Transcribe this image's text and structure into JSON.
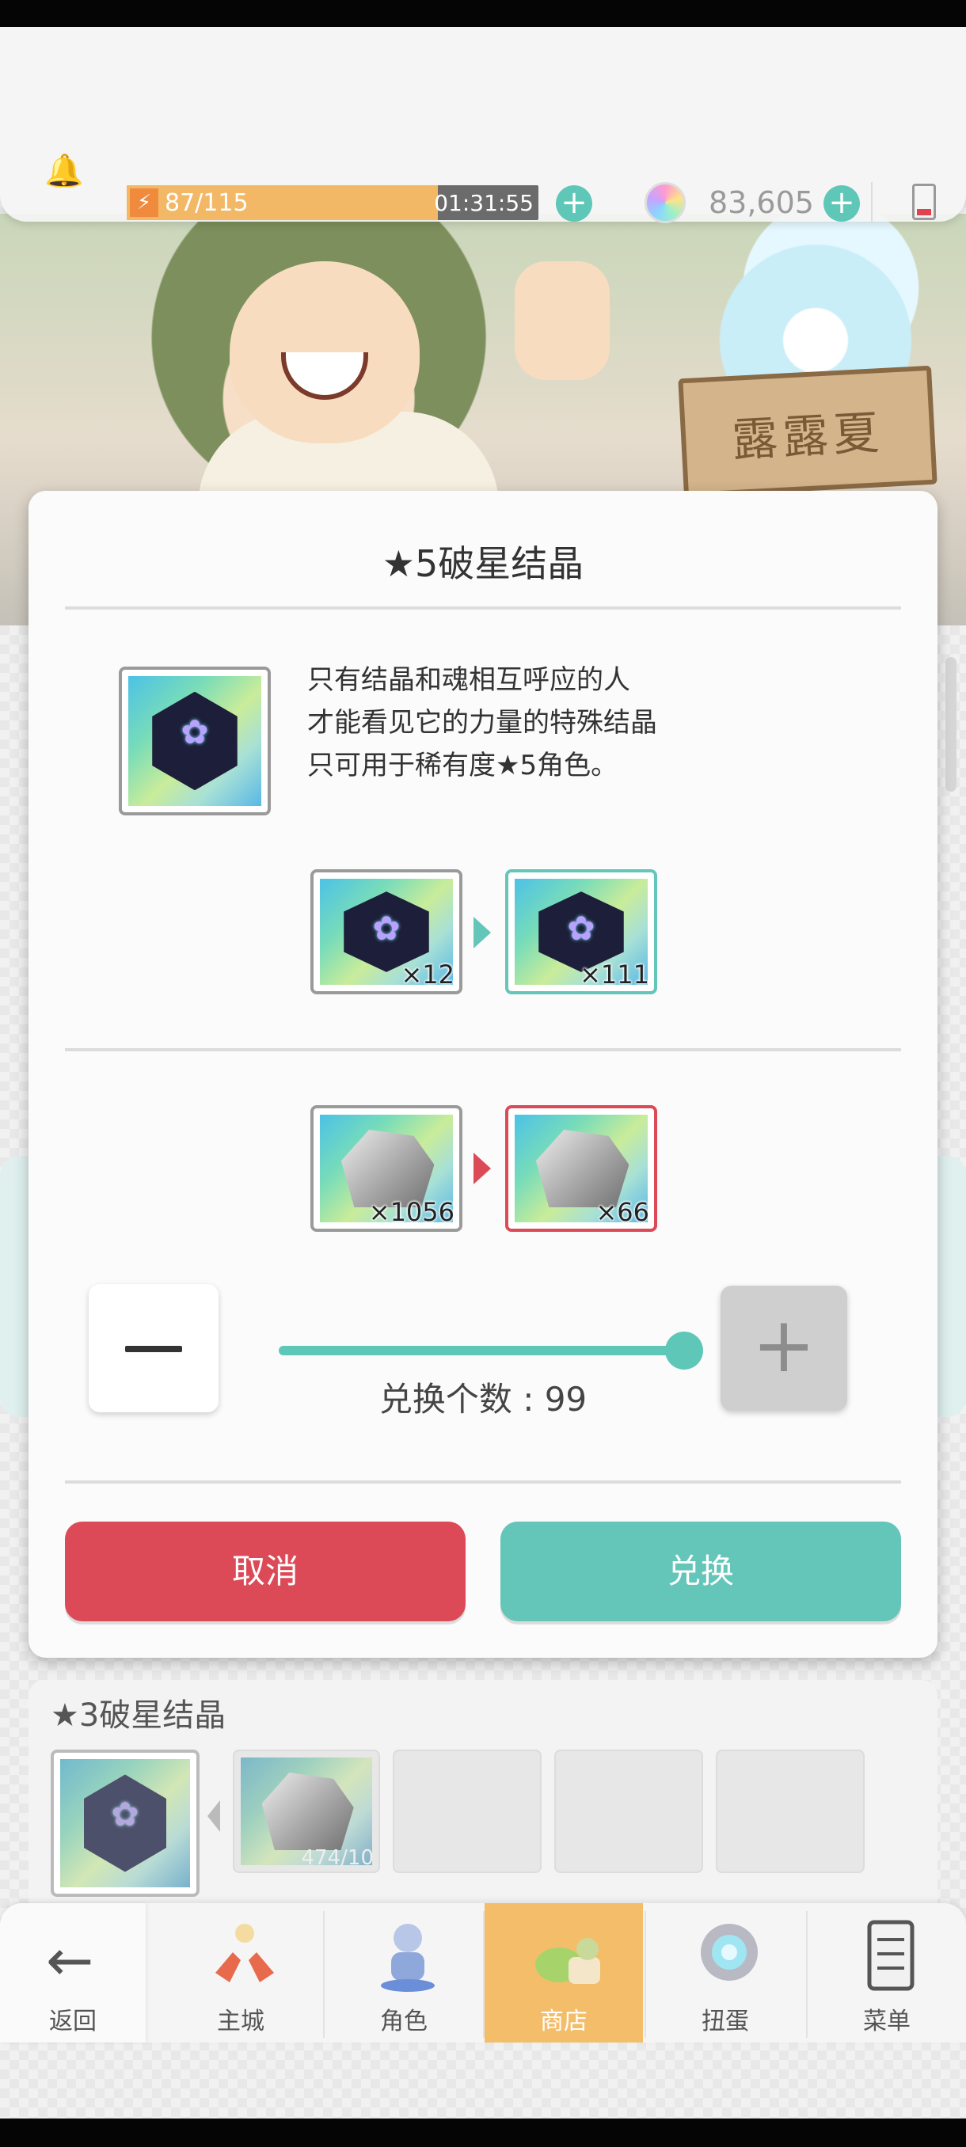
{
  "hud": {
    "stamina_text": "87/115",
    "stamina_fraction": 0.7565,
    "stamina_timer": "01:31:55",
    "gems": "83,605",
    "colors": {
      "stamina": "#f3b866",
      "plus": "#5fc7b7"
    }
  },
  "banner": {
    "sign_text": "露露夏"
  },
  "modal": {
    "title": "★5破星结晶",
    "description": [
      "只有结晶和魂相互呼应的人",
      "才能看见它的力量的特殊结晶",
      "只可用于稀有度★5角色。"
    ],
    "crystal_from": "×12",
    "crystal_to": "×111",
    "stone_from": "×1056",
    "stone_to": "×66",
    "slider_fraction": 1.0,
    "exchange_label": "兑换个数 : 99",
    "cancel": "取消",
    "confirm": "兑换",
    "colors": {
      "cancel": "#dd4a57",
      "confirm": "#63c6b8",
      "decrease_arrow": "#dd4a57",
      "increase_arrow": "#63c6b8"
    }
  },
  "section3": {
    "title": "★3破星结晶",
    "stone_count": "474/10"
  },
  "nav": {
    "back": "返回",
    "items": [
      {
        "label": "主城",
        "icon": "castle-icon"
      },
      {
        "label": "角色",
        "icon": "character-icon"
      },
      {
        "label": "商店",
        "icon": "shop-icon"
      },
      {
        "label": "扭蛋",
        "icon": "gacha-icon"
      },
      {
        "label": "菜单",
        "icon": "menu-icon"
      }
    ]
  }
}
